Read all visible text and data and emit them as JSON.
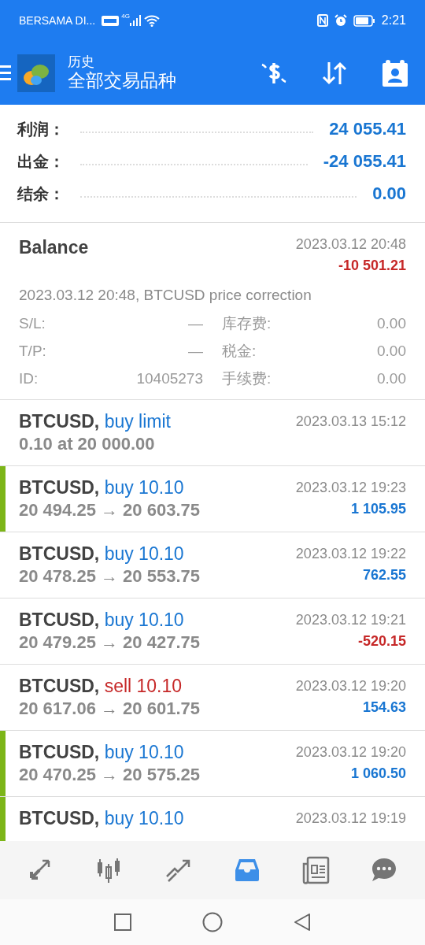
{
  "status_bar": {
    "carrier": "BERSAMA DI...",
    "network": "4G",
    "time": "2:21"
  },
  "app_bar": {
    "title": "历史",
    "subtitle": "全部交易品种"
  },
  "summary": [
    {
      "label": "利润：",
      "value": "24 055.41"
    },
    {
      "label": "出金：",
      "value": "-24 055.41"
    },
    {
      "label": "结余：",
      "value": "0.00"
    }
  ],
  "balance": {
    "title": "Balance",
    "date": "2023.03.12 20:48",
    "amount": "-10 501.21",
    "loss": true,
    "comment": "2023.03.12 20:48, BTCUSD price correction",
    "details": [
      {
        "label": "S/L:",
        "value": "—",
        "label_2": "库存费:",
        "value_2": "0.00"
      },
      {
        "label": "T/P:",
        "value": "—",
        "label_2": "税金:",
        "value_2": "0.00"
      },
      {
        "label": "ID:",
        "value": "10405273",
        "label_2": "手续费:",
        "value_2": "0.00"
      }
    ]
  },
  "deals": [
    {
      "kind": "order",
      "marked": false,
      "symbol": "BTCUSD,",
      "action": "buy limit",
      "short": false,
      "prices": "0.10 at 20 000.00",
      "date": "2023.03.13 15:12"
    },
    {
      "kind": "deal",
      "marked": true,
      "symbol": "BTCUSD,",
      "action": "buy 10.10",
      "short": false,
      "prices": "20 494.25 → 20 603.75",
      "date": "2023.03.12 19:23",
      "profit": "1 105.95",
      "loss": false
    },
    {
      "kind": "deal",
      "marked": false,
      "symbol": "BTCUSD,",
      "action": "buy 10.10",
      "short": false,
      "prices": "20 478.25 → 20 553.75",
      "date": "2023.03.12 19:22",
      "profit": "762.55",
      "loss": false
    },
    {
      "kind": "deal",
      "marked": false,
      "symbol": "BTCUSD,",
      "action": "buy 10.10",
      "short": false,
      "prices": "20 479.25 → 20 427.75",
      "date": "2023.03.12 19:21",
      "profit": "-520.15",
      "loss": true
    },
    {
      "kind": "deal",
      "marked": false,
      "symbol": "BTCUSD,",
      "action": "sell 10.10",
      "short": true,
      "prices": "20 617.06 → 20 601.75",
      "date": "2023.03.12 19:20",
      "profit": "154.63",
      "loss": false
    },
    {
      "kind": "deal",
      "marked": true,
      "symbol": "BTCUSD,",
      "action": "buy 10.10",
      "short": false,
      "prices": "20 470.25 → 20 575.25",
      "date": "2023.03.12 19:20",
      "profit": "1 060.50",
      "loss": false
    },
    {
      "kind": "cut",
      "marked": true,
      "symbol": "BTCUSD,",
      "action": "buy 10.10",
      "short": false,
      "date": "2023.03.12 19:19"
    }
  ],
  "bottom_nav": [
    {
      "selected": false
    },
    {
      "selected": false
    },
    {
      "selected": false
    },
    {
      "selected": true
    },
    {
      "selected": false
    },
    {
      "selected": false
    }
  ]
}
